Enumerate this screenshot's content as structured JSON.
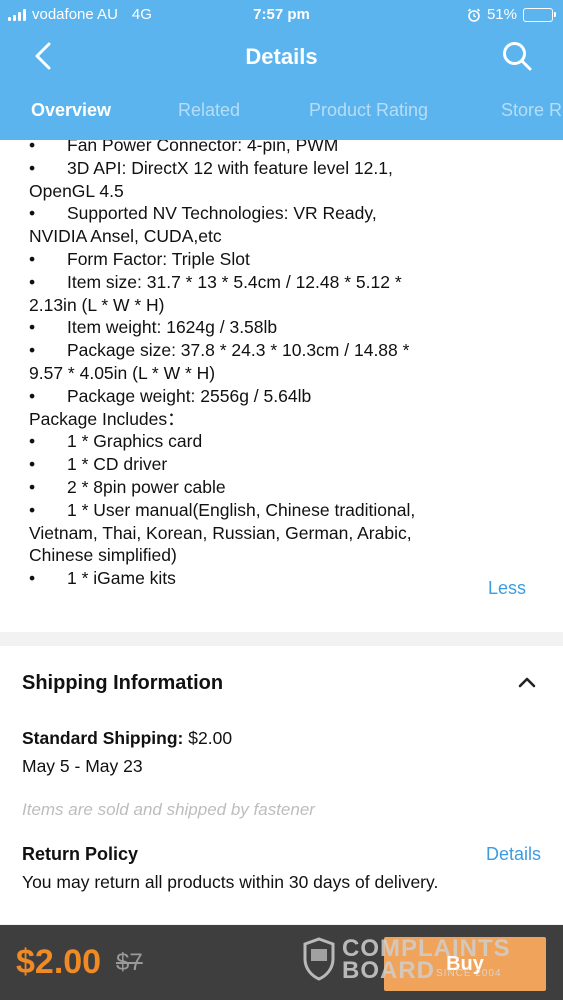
{
  "status_bar": {
    "carrier": "vodafone AU",
    "network": "4G",
    "time": "7:57 pm",
    "battery": "51%",
    "battery_level": 0.51
  },
  "header": {
    "title": "Details",
    "tabs": [
      {
        "label": "Overview",
        "active": true
      },
      {
        "label": "Related",
        "active": false
      },
      {
        "label": "Product Rating",
        "active": false
      },
      {
        "label": "Store R",
        "active": false
      }
    ]
  },
  "description": {
    "lines": [
      {
        "bullet": "•",
        "text": "Fan Power Connector: 4-pin, PWM"
      },
      {
        "bullet": "•",
        "text": "3D API: DirectX 12 with feature level 12.1,"
      },
      {
        "bullet": "",
        "text": "OpenGL 4.5"
      },
      {
        "bullet": "•",
        "text": "Supported NV Technologies: VR Ready,"
      },
      {
        "bullet": "",
        "text": "NVIDIA Ansel, CUDA,etc"
      },
      {
        "bullet": "•",
        "text": "Form Factor: Triple Slot"
      },
      {
        "bullet": "•",
        "text": "Item size: 31.7 * 13 * 5.4cm / 12.48 * 5.12 *"
      },
      {
        "bullet": "",
        "text": "2.13in (L * W * H)"
      },
      {
        "bullet": "•",
        "text": "Item weight: 1624g / 3.58lb"
      },
      {
        "bullet": "•",
        "text": "Package size: 37.8 * 24.3 * 10.3cm / 14.88 *"
      },
      {
        "bullet": "",
        "text": "9.57 * 4.05in (L * W * H)"
      },
      {
        "bullet": "•",
        "text": "Package weight: 2556g / 5.64lb"
      },
      {
        "bullet": "",
        "text": "Package Includes："
      },
      {
        "bullet": "•",
        "text": "1 * Graphics card"
      },
      {
        "bullet": "•",
        "text": "1 * CD driver"
      },
      {
        "bullet": "•",
        "text": "2 * 8pin power cable"
      },
      {
        "bullet": "•",
        "text": "1 * User manual(English, Chinese traditional,"
      },
      {
        "bullet": "",
        "text": "Vietnam, Thai, Korean, Russian, German, Arabic,"
      },
      {
        "bullet": "",
        "text": "Chinese simplified)"
      },
      {
        "bullet": "•",
        "text": "1 * iGame kits"
      }
    ],
    "less_label": "Less"
  },
  "shipping": {
    "title": "Shipping Information",
    "standard_label": "Standard Shipping:",
    "standard_price": "$2.00",
    "dates": "May 5 - May 23",
    "sold_by": "Items are sold and shipped by fastener",
    "return_title": "Return Policy",
    "return_details": "Details",
    "return_text": "You may return all products within 30 days of delivery."
  },
  "bottom_bar": {
    "price": "$2.00",
    "old_price": "$7",
    "buy_label": "Buy"
  },
  "watermark": {
    "line1": "COMPLAINTS",
    "line2": "BOARD",
    "line3": "SINCE 2004"
  },
  "colors": {
    "header": "#5bb4ee",
    "accent_link": "#3c9ce0",
    "price": "#f08a24",
    "buy_button": "#f0a35a",
    "bottom_bar": "#3e3e3e"
  }
}
